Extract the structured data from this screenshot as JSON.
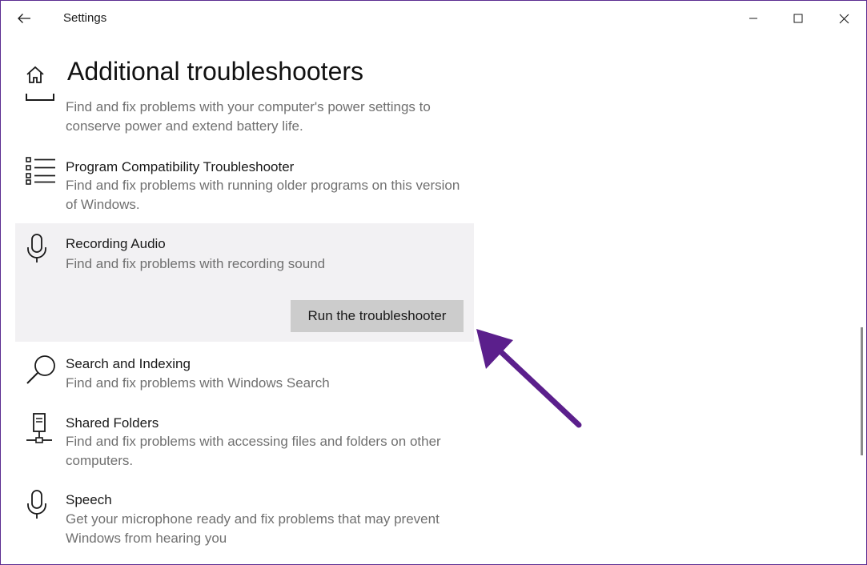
{
  "window": {
    "title": "Settings"
  },
  "page": {
    "title": "Additional troubleshooters"
  },
  "items": [
    {
      "title": "",
      "description": "Find and fix problems with your computer's power settings to conserve power and extend battery life.",
      "icon": "power-icon"
    },
    {
      "title": "Program Compatibility Troubleshooter",
      "description": "Find and fix problems with running older programs on this version of Windows.",
      "icon": "list-icon"
    },
    {
      "title": "Recording Audio",
      "description": "Find and fix problems with recording sound",
      "icon": "microphone-icon",
      "selected": true,
      "action_label": "Run the troubleshooter"
    },
    {
      "title": "Search and Indexing",
      "description": "Find and fix problems with Windows Search",
      "icon": "search-icon"
    },
    {
      "title": "Shared Folders",
      "description": "Find and fix problems with accessing files and folders on other computers.",
      "icon": "network-folder-icon"
    },
    {
      "title": "Speech",
      "description": "Get your microphone ready and fix problems that may prevent Windows from hearing you",
      "icon": "microphone-icon"
    }
  ],
  "colors": {
    "window_border": "#5c2d91",
    "selected_bg": "#f2f1f3",
    "button_bg": "#cccccc",
    "arrow": "#5b1f8c",
    "description_text": "#707070"
  }
}
